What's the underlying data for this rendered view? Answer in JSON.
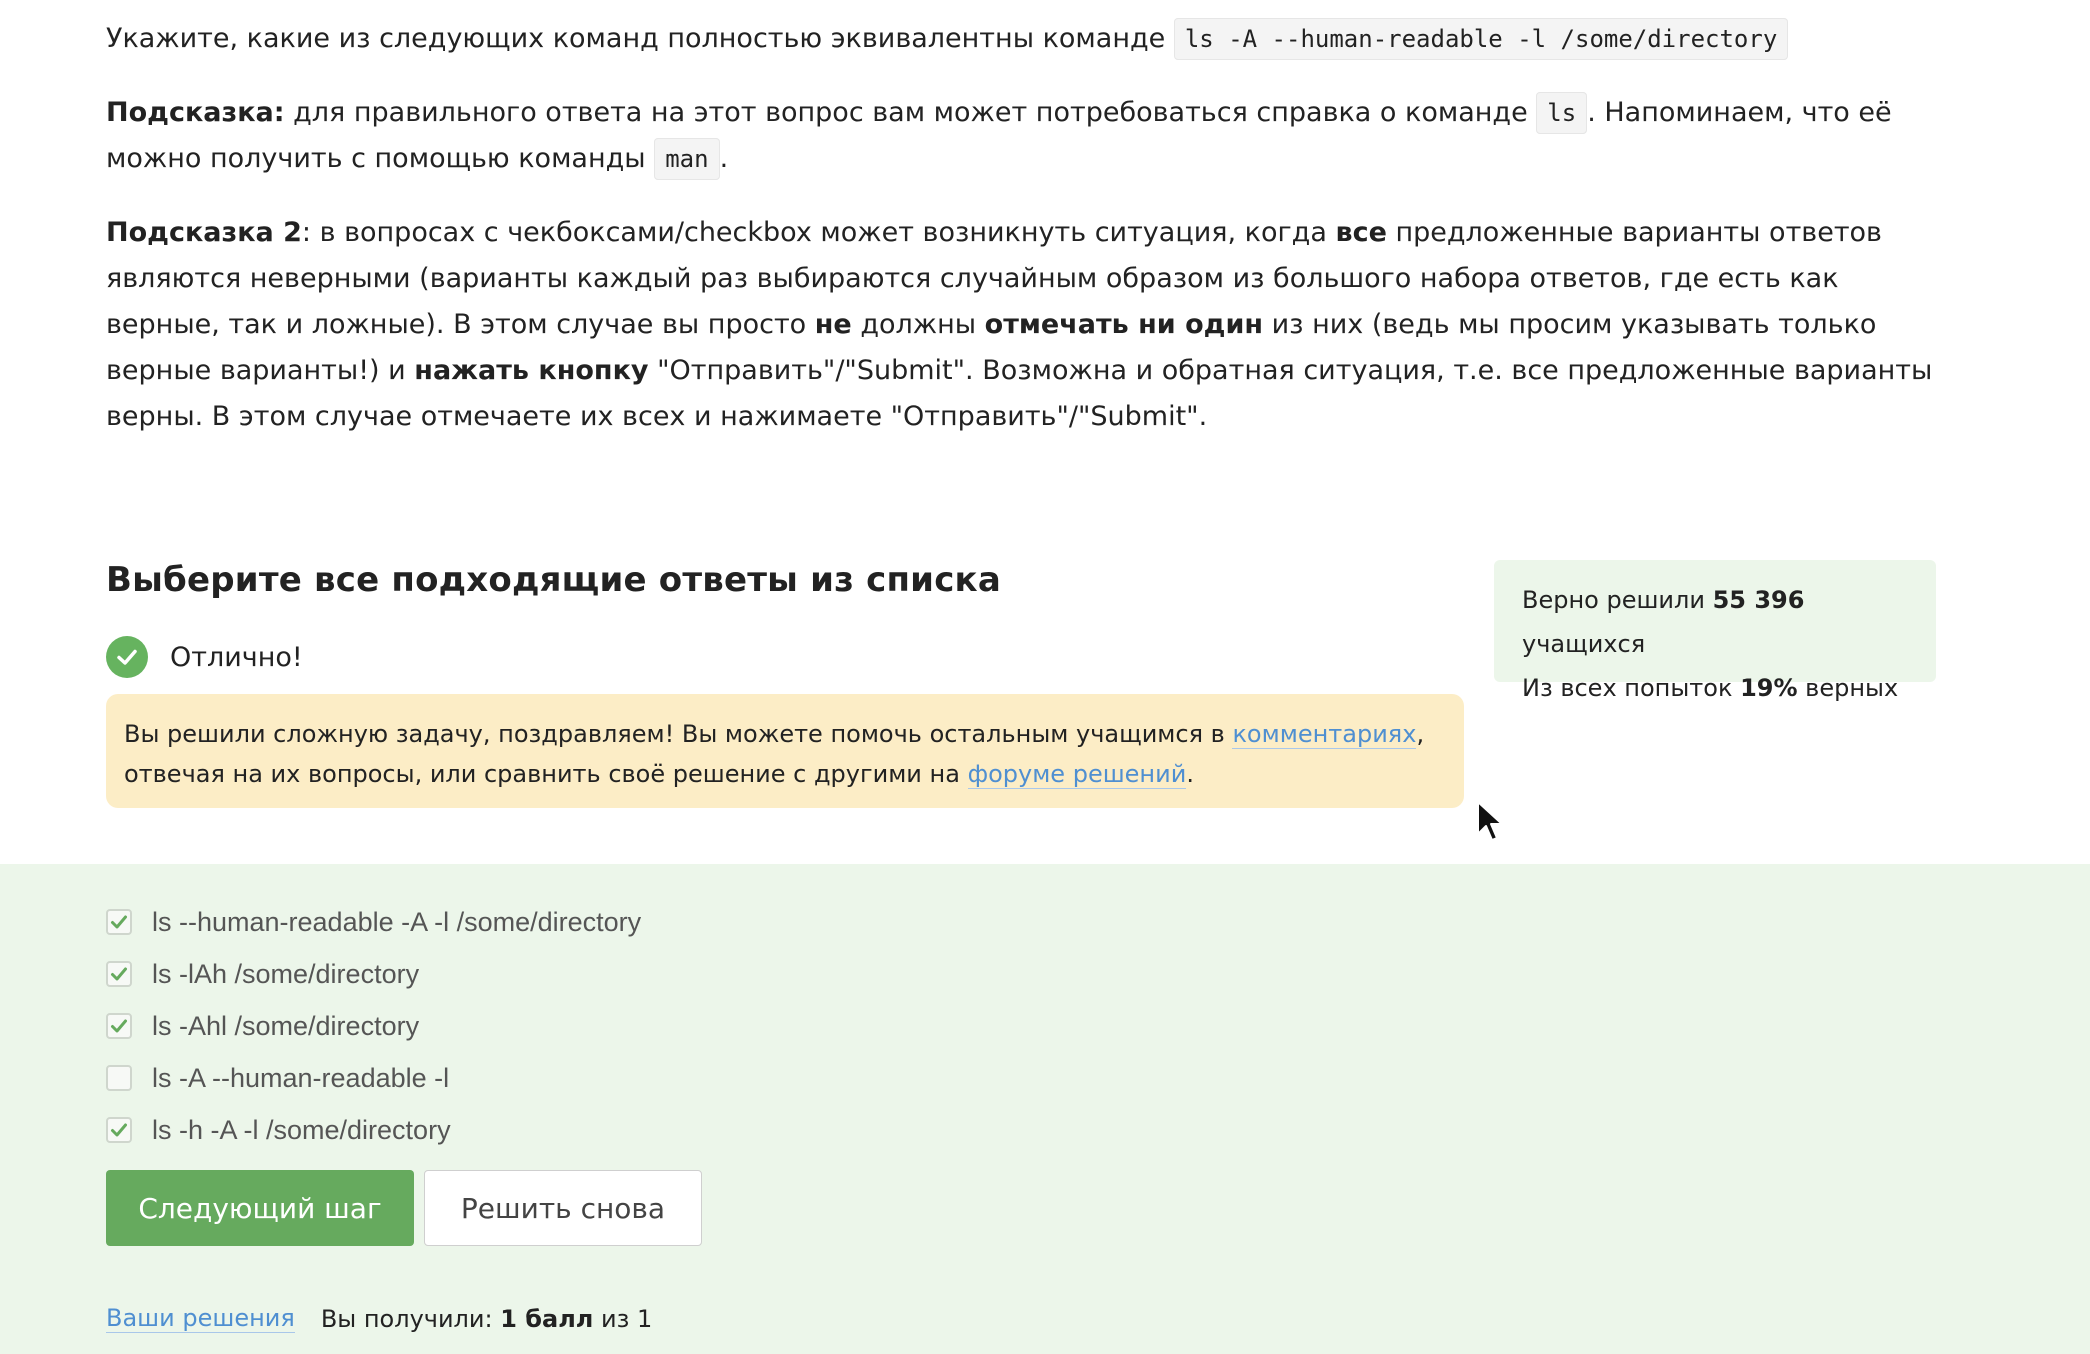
{
  "question": {
    "intro": "Укажите, какие из следующих команд полностью эквивалентны команде",
    "command": "ls -A --human-readable -l /some/directory",
    "hint1_label": "Подсказка:",
    "hint1_text": " для правильного ответа на этот вопрос вам может потребоваться справка о команде ",
    "hint1_code1": "ls",
    "hint1_text2": ". Напоминаем, что её можно получить с помощью команды ",
    "hint1_code2": "man",
    "hint1_end": ".",
    "hint2_label": "Подсказка 2",
    "hint2_t1": ": в вопросах с чекбоксами/checkbox может возникнуть ситуация, когда ",
    "hint2_b1": "все",
    "hint2_t2": " предложенные варианты ответов являются неверными (варианты каждый раз выбираются случайным образом из большого набора ответов, где есть как верные, так и ложные). В этом случае вы просто ",
    "hint2_b2": "не",
    "hint2_t3": " должны ",
    "hint2_b3": "отмечать ни один",
    "hint2_t4": " из них (ведь мы просим указывать только верные варианты!) и ",
    "hint2_b4": "нажать кнопку",
    "hint2_t5": " \"Отправить\"/\"Submit\". Возможна и обратная ситуация, т.е. все предложенные варианты верны. В этом случае отмечаете их всех и нажимаете \"Отправить\"/\"Submit\"."
  },
  "task": {
    "title": "Выберите все подходящие ответы из списка",
    "status": "Отлично!",
    "congrats_t1": "Вы решили сложную задачу, поздравляем! Вы можете помочь остальным учащимся в ",
    "congrats_link1": "комментариях",
    "congrats_t2": ", отвечая на их вопросы, или сравнить своё решение с другими на ",
    "congrats_link2": "форуме решений",
    "congrats_t3": "."
  },
  "stats": {
    "line1_pre": "Верно решили ",
    "line1_num": "55 396",
    "line1_post": " учащихся",
    "line2_pre": "Из всех попыток ",
    "line2_num": "19%",
    "line2_post": " верных"
  },
  "options": [
    {
      "label": "ls --human-readable -A  -l /some/directory",
      "checked": true
    },
    {
      "label": "ls -lAh /some/directory",
      "checked": true
    },
    {
      "label": "ls -Ahl /some/directory",
      "checked": true
    },
    {
      "label": "ls -A --human-readable -l",
      "checked": false
    },
    {
      "label": "ls -h -A -l /some/directory",
      "checked": true
    }
  ],
  "buttons": {
    "next": "Следующий шаг",
    "again": "Решить снова"
  },
  "footer": {
    "solutions_link": "Ваши решения",
    "score_pre": "Вы получили: ",
    "score_bold": "1 балл",
    "score_post": " из 1"
  },
  "colors": {
    "accent_green": "#66aa5e",
    "success_bg": "#ecf6ea",
    "warning_bg": "#fcedc6",
    "link_blue": "#4f8fd1"
  }
}
